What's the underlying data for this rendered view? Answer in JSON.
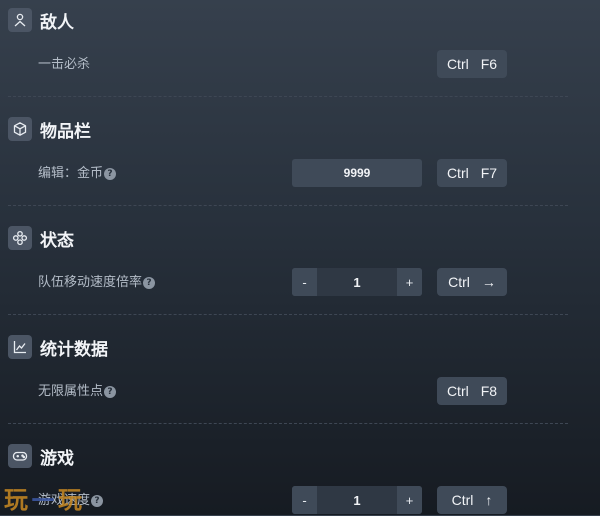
{
  "sections": [
    {
      "title": "敌人",
      "icon": "person-icon",
      "rows": [
        {
          "label": "一击必杀",
          "hotkey": [
            "Ctrl",
            "F6"
          ]
        }
      ]
    },
    {
      "title": "物品栏",
      "icon": "cube-icon",
      "rows": [
        {
          "label": "编辑：金币",
          "value": "9999",
          "hotkey": [
            "Ctrl",
            "F7"
          ]
        }
      ]
    },
    {
      "title": "状态",
      "icon": "gamepad-cross-icon",
      "rows": [
        {
          "label": "队伍移动速度倍率",
          "stepper": {
            "minus": "-",
            "value": "1",
            "plus": "+"
          },
          "hotkey": [
            "Ctrl",
            "→"
          ]
        }
      ]
    },
    {
      "title": "统计数据",
      "icon": "line-chart-icon",
      "rows": [
        {
          "label": "无限属性点",
          "hotkey": [
            "Ctrl",
            "F8"
          ]
        }
      ]
    },
    {
      "title": "游戏",
      "icon": "controller-icon",
      "rows": [
        {
          "label": "游戏速度",
          "stepper": {
            "minus": "-",
            "value": "1",
            "plus": "+"
          },
          "hotkey": [
            "Ctrl",
            "↑"
          ]
        }
      ]
    }
  ],
  "help_glyph": "?",
  "watermark": {
    "left": "玩",
    "dash": "—",
    "right": "玩"
  },
  "colors": {
    "accent_panel": "#3f4a58",
    "icon_bg": "#4b5564",
    "watermark": "#c98a22"
  }
}
